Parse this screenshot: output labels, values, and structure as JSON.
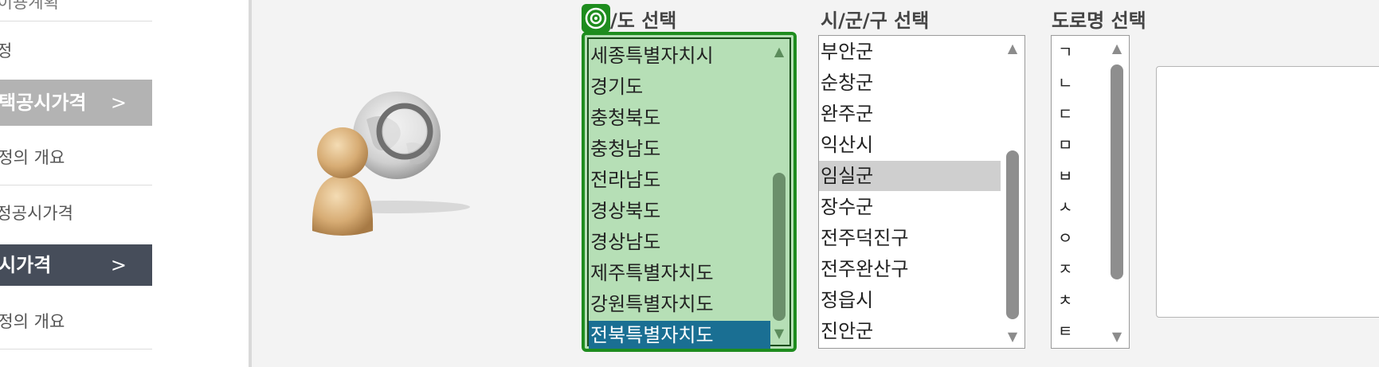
{
  "sidebar": {
    "items": [
      {
        "label": "토지이용계획",
        "style": "plain"
      },
      {
        "label": "정",
        "style": "plain"
      },
      {
        "label": "주택공시가격",
        "style": "active-gray"
      },
      {
        "label": "산정의 개요",
        "style": "plain"
      },
      {
        "label": "결정공시가격",
        "style": "plain"
      },
      {
        "label": "공시가격",
        "style": "active-dark"
      },
      {
        "label": "산정의 개요",
        "style": "plain"
      }
    ],
    "chevron": ">"
  },
  "headers": {
    "sido": "/도 선택",
    "sigungu": "시/군/구 선택",
    "road": "도로명 선택"
  },
  "sido_list": {
    "items": [
      "세종특별자치시",
      "경기도",
      "충청북도",
      "충청남도",
      "전라남도",
      "경상북도",
      "경상남도",
      "제주특별자치도",
      "강원특별자치도",
      "전북특별자치도"
    ],
    "selected": "전북특별자치도"
  },
  "sigungu_list": {
    "items": [
      "부안군",
      "순창군",
      "완주군",
      "익산시",
      "임실군",
      "장수군",
      "전주덕진구",
      "전주완산구",
      "정읍시",
      "진안군"
    ],
    "selected": "임실군"
  },
  "road_list": {
    "items": [
      "ㄱ",
      "ㄴ",
      "ㄷ",
      "ㅁ",
      "ㅂ",
      "ㅅ",
      "ㅇ",
      "ㅈ",
      "ㅊ",
      "ㅌ"
    ]
  },
  "scroll": {
    "up_glyph": "▲",
    "down_glyph": "▼"
  },
  "icons": {
    "target": "target-icon",
    "illustration": "person-magnifier-icon"
  },
  "colors": {
    "focus_green": "#1e8c1e",
    "list_bg_green": "#b6dfb6",
    "selected_blue": "#1a6f93",
    "selected_gray": "#cfcfcf",
    "sidebar_dark": "#464d5a"
  }
}
